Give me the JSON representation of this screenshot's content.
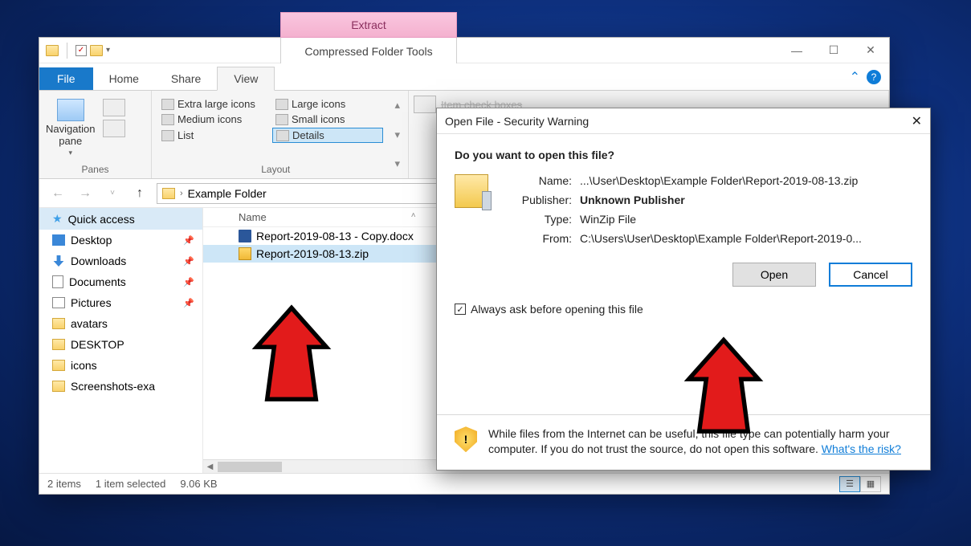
{
  "window": {
    "title": "Example Folder",
    "tabs": {
      "file": "File",
      "home": "Home",
      "share": "Share",
      "view": "View"
    },
    "contextual": {
      "header": "Extract",
      "tab": "Compressed Folder Tools"
    },
    "winbtns": {
      "min": "—",
      "max": "☐",
      "close": "✕"
    },
    "collapse": "⌃"
  },
  "ribbon": {
    "panes_label": "Panes",
    "nav": "Navigation\npane",
    "layout_label": "Layout",
    "opts": {
      "xl": "Extra large icons",
      "large": "Large icons",
      "med": "Medium icons",
      "small": "Small icons",
      "list": "List",
      "details": "Details"
    },
    "truncated": "Item check boxes"
  },
  "addr": {
    "folder": "Example Folder"
  },
  "side": {
    "quick": "Quick access",
    "items": [
      "Desktop",
      "Downloads",
      "Documents",
      "Pictures",
      "avatars",
      "DESKTOP",
      "icons",
      "Screenshots-exa"
    ]
  },
  "files": {
    "col": "Name",
    "rows": [
      "Report-2019-08-13 - Copy.docx",
      "Report-2019-08-13.zip"
    ]
  },
  "status": {
    "count": "2 items",
    "sel": "1 item selected",
    "size": "9.06 KB"
  },
  "dialog": {
    "title": "Open File - Security Warning",
    "question": "Do you want to open this file?",
    "labels": {
      "name": "Name:",
      "publisher": "Publisher:",
      "type": "Type:",
      "from": "From:"
    },
    "values": {
      "name": "...\\User\\Desktop\\Example Folder\\Report-2019-08-13.zip",
      "publisher": "Unknown Publisher",
      "type": "WinZip File",
      "from": "C:\\Users\\User\\Desktop\\Example Folder\\Report-2019-0..."
    },
    "open": "Open",
    "cancel": "Cancel",
    "always": "Always ask before opening this file",
    "warn1": "While files from the Internet can be useful, this file type can potentially harm your computer. If you do not trust the source, do not open this software. ",
    "risk": "What's the risk?"
  }
}
